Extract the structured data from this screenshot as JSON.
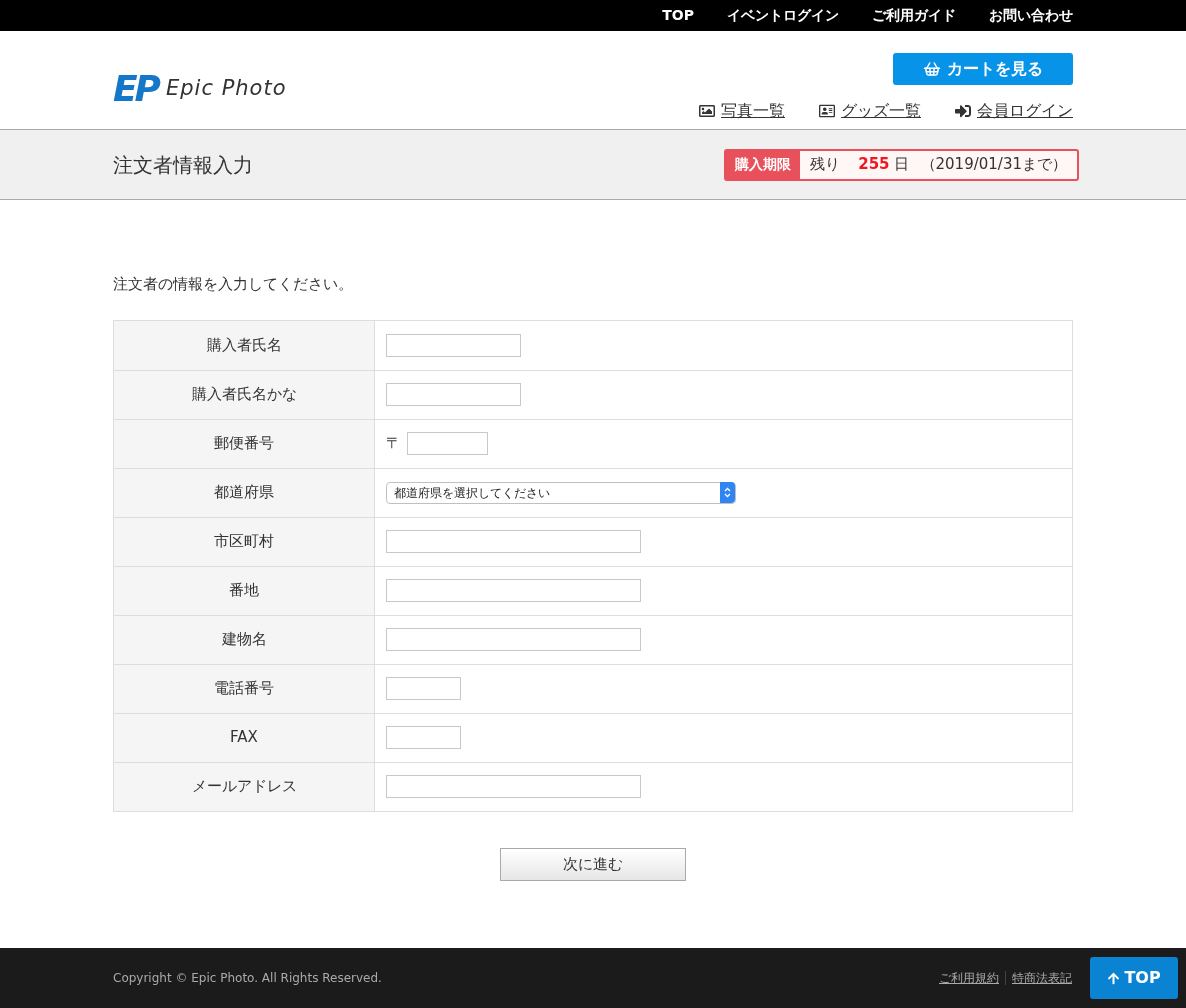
{
  "top_nav": [
    "TOP",
    "イベントログイン",
    "ご利用ガイド",
    "お問い合わせ"
  ],
  "logo": {
    "mark": "EP",
    "name": "Epic Photo"
  },
  "cart_button": "カートを見る",
  "header_links": [
    {
      "kind": "photo",
      "label": "写真一覧"
    },
    {
      "kind": "goods",
      "label": "グッズ一覧"
    },
    {
      "kind": "login",
      "label": "会員ログイン"
    }
  ],
  "page_title": "注文者情報入力",
  "deadline": {
    "label": "購入期限",
    "prefix": "残り",
    "days": "255",
    "unit": "日",
    "until": "（2019/01/31まで）"
  },
  "intro": "注文者の情報を入力してください。",
  "form_rows": [
    {
      "label": "購入者氏名",
      "kind": "medium"
    },
    {
      "label": "購入者氏名かな",
      "kind": "medium"
    },
    {
      "label": "郵便番号",
      "kind": "postal",
      "prefix": "〒"
    },
    {
      "label": "都道府県",
      "kind": "select",
      "placeholder": "都道府県を選択してください"
    },
    {
      "label": "市区町村",
      "kind": "long"
    },
    {
      "label": "番地",
      "kind": "long"
    },
    {
      "label": "建物名",
      "kind": "long"
    },
    {
      "label": "電話番号",
      "kind": "short"
    },
    {
      "label": "FAX",
      "kind": "short"
    },
    {
      "label": "メールアドレス",
      "kind": "long"
    }
  ],
  "next_button": "次に進む",
  "footer": {
    "copyright": "Copyright © Epic Photo. All Rights Reserved.",
    "links": [
      "ご利用規約",
      "特商法表記"
    ],
    "top_button": "TOP"
  }
}
